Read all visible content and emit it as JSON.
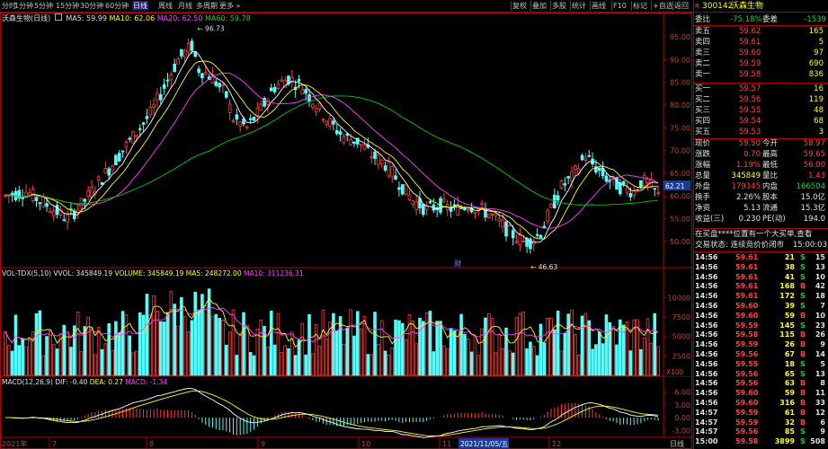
{
  "toolbar": {
    "left": [
      "分时",
      "1分钟",
      "5分钟",
      "15分钟",
      "30分钟",
      "60分钟",
      "日线",
      "周线",
      "月线",
      "多周期",
      "更多"
    ],
    "right": [
      "复权",
      "叠加",
      "多股",
      "统计",
      "画线",
      "F10",
      "标记",
      "+自选",
      "返回"
    ]
  },
  "main_chart": {
    "stock_label": "沃森生物(日线)",
    "ma5_label": "MA5: 59.99",
    "ma10_label": "MA10: 62.06",
    "ma20_label": "MA20: 62.50",
    "ma60_label": "MA60: 59.78",
    "high_label": "96.73",
    "low_label": "46.63",
    "last_tag": "62.21",
    "cai_marker": "财",
    "y_ticks": [
      "95.00",
      "90.00",
      "85.00",
      "80.00",
      "75.00",
      "70.00",
      "65.00",
      "60.00",
      "55.00",
      "50.00"
    ]
  },
  "volume_panel": {
    "title": "VOL-TDX(5,10)",
    "vvol": "VVOL: 345849.19",
    "volume": "VOLUME: 345849.19",
    "ma5": "MA5: 248272.00",
    "ma10": "MA10: 311236.31",
    "y_ticks": [
      "10000",
      "7500",
      "5000",
      "2500"
    ],
    "unit": "X100"
  },
  "macd_panel": {
    "title": "MACD(12,26,9)",
    "dif": "DIF: -0.40",
    "dea": "DEA: 0.27",
    "macd": "MACD: -1.34",
    "y_ticks": [
      "6.00",
      "3.00",
      "0.00",
      "-3.00"
    ]
  },
  "date_axis": {
    "labels": [
      "2021年",
      "7",
      "8",
      "9",
      "10",
      "11",
      "12"
    ],
    "cursor_date": "2021/11/05/五",
    "period": "日线"
  },
  "quote": {
    "code": "300142",
    "name": "沃森生物",
    "weibi_label": "委比",
    "weibi": "-75.18%",
    "weicha_label": "委差",
    "weicha": "-1539",
    "asks": [
      {
        "label": "卖五",
        "price": "59.62",
        "vol": "165"
      },
      {
        "label": "卖四",
        "price": "59.61",
        "vol": "5"
      },
      {
        "label": "卖三",
        "price": "59.60",
        "vol": "97"
      },
      {
        "label": "卖二",
        "price": "59.59",
        "vol": "690"
      },
      {
        "label": "卖一",
        "price": "59.58",
        "vol": "836"
      }
    ],
    "bids": [
      {
        "label": "买一",
        "price": "59.57",
        "vol": "16"
      },
      {
        "label": "买二",
        "price": "59.56",
        "vol": "119"
      },
      {
        "label": "买三",
        "price": "59.55",
        "vol": "48"
      },
      {
        "label": "买四",
        "price": "59.54",
        "vol": "68"
      },
      {
        "label": "买五",
        "price": "59.53",
        "vol": "3"
      }
    ],
    "stats": [
      {
        "l1": "现价",
        "v1": "59.50",
        "l2": "今开",
        "v2": "58.97"
      },
      {
        "l1": "涨跌",
        "v1": "0.70",
        "l2": "最高",
        "v2": "59.65"
      },
      {
        "l1": "涨幅",
        "v1": "1.19%",
        "l2": "最低",
        "v2": "56.00"
      },
      {
        "l1": "总量",
        "v1": "345849",
        "l2": "量比",
        "v2": "1.43"
      },
      {
        "l1": "外盘",
        "v1": "179345",
        "l2": "内盘",
        "v2": "166504"
      },
      {
        "l1": "换手",
        "v1": "2.26%",
        "l2": "股本",
        "v2": "15.0亿"
      },
      {
        "l1": "净资",
        "v1": "5.13",
        "l2": "流通",
        "v2": "15.3亿"
      },
      {
        "l1": "收益(三)",
        "v1": "0.230",
        "l2": "PE(动)",
        "v2": "194.0"
      }
    ],
    "news": "在买盘****位置有一个大买单,查看",
    "trade_status": "交易状态: 连续竞价价闭市",
    "trade_time": "15:00:03"
  },
  "ticks": [
    {
      "t": "14:56",
      "p": "59.61",
      "v": "21",
      "s": "S",
      "n": "15"
    },
    {
      "t": "14:56",
      "p": "59.61",
      "v": "38",
      "s": "S",
      "n": "13"
    },
    {
      "t": "14:56",
      "p": "59.61",
      "v": "41",
      "s": "S",
      "n": "10"
    },
    {
      "t": "14:56",
      "p": "59.61",
      "v": "168",
      "s": "B",
      "n": "42"
    },
    {
      "t": "14:56",
      "p": "59.61",
      "v": "172",
      "s": "S",
      "n": "18"
    },
    {
      "t": "14:56",
      "p": "59.60",
      "v": "39",
      "s": "S",
      "n": "7"
    },
    {
      "t": "14:56",
      "p": "59.60",
      "v": "59",
      "s": "B",
      "n": "10"
    },
    {
      "t": "14:56",
      "p": "59.59",
      "v": "145",
      "s": "S",
      "n": "23"
    },
    {
      "t": "14:56",
      "p": "59.58",
      "v": "115",
      "s": "B",
      "n": "26"
    },
    {
      "t": "14:56",
      "p": "59.59",
      "v": "26",
      "s": "B",
      "n": "9"
    },
    {
      "t": "14:56",
      "p": "59.56",
      "v": "67",
      "s": "B",
      "n": "14"
    },
    {
      "t": "14:56",
      "p": "59.55",
      "v": "18",
      "s": "S",
      "n": "5"
    },
    {
      "t": "14:56",
      "p": "59.56",
      "v": "65",
      "s": "S",
      "n": "13"
    },
    {
      "t": "14:56",
      "p": "59.56",
      "v": "63",
      "s": "B",
      "n": "8"
    },
    {
      "t": "14:56",
      "p": "59.60",
      "v": "59",
      "s": "B",
      "n": "11"
    },
    {
      "t": "14:56",
      "p": "59.60",
      "v": "316",
      "s": "B",
      "n": "33"
    },
    {
      "t": "14:57",
      "p": "59.59",
      "v": "61",
      "s": "B",
      "n": "12"
    },
    {
      "t": "14:57",
      "p": "59.59",
      "v": "32",
      "s": "B",
      "n": "6"
    },
    {
      "t": "14:57",
      "p": "59.56",
      "v": "85",
      "s": "S",
      "n": "9"
    },
    {
      "t": "15:00",
      "p": "59.58",
      "v": "3899",
      "s": "S",
      "n": "508"
    }
  ],
  "colors": {
    "up": "#ff3b3b",
    "down": "#54fcfc",
    "ma5": "#ffffff",
    "ma10": "#ffff00",
    "ma20": "#ff40ff",
    "ma60": "#00cc00",
    "grid": "#b00000"
  }
}
